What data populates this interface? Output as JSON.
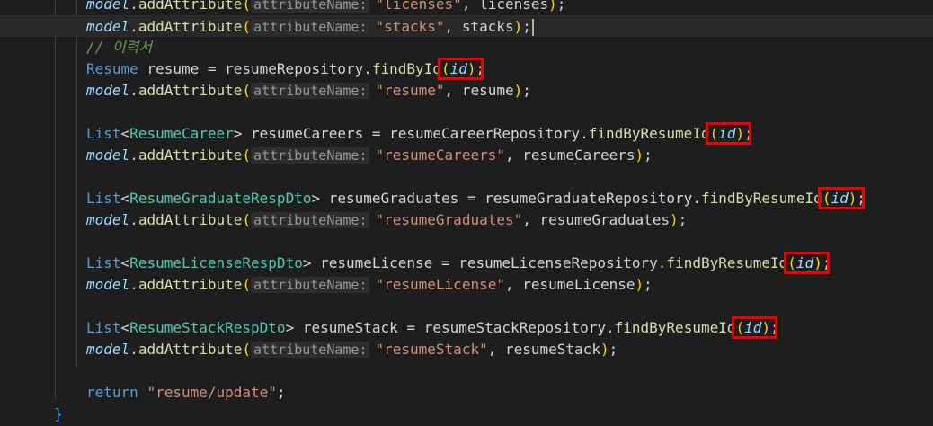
{
  "editor": {
    "hint_label": "attributeName:",
    "lines": [
      {
        "indent": 2,
        "tokens": [
          [
            "model",
            "var"
          ],
          [
            ".",
            "plain"
          ],
          [
            "addAttribute",
            "fn"
          ],
          [
            "(",
            "p1"
          ],
          [
            "HINT",
            "hint"
          ],
          [
            "\"licenses\"",
            "str"
          ],
          [
            ", ",
            "plain"
          ],
          [
            "licenses",
            "plain"
          ],
          [
            ")",
            "p1"
          ],
          [
            ";",
            "plain"
          ]
        ]
      },
      {
        "indent": 2,
        "current": true,
        "cursor": true,
        "tokens": [
          [
            "model",
            "var"
          ],
          [
            ".",
            "plain"
          ],
          [
            "addAttribute",
            "fn"
          ],
          [
            "(",
            "p1"
          ],
          [
            "HINT",
            "hint"
          ],
          [
            "\"stacks\"",
            "str"
          ],
          [
            ", ",
            "plain"
          ],
          [
            "stacks",
            "plain"
          ],
          [
            ")",
            "p1"
          ],
          [
            ";",
            "plain"
          ]
        ]
      },
      {
        "indent": 2,
        "tokens": [
          [
            "// 이력서",
            "cmt"
          ]
        ]
      },
      {
        "indent": 2,
        "tokens": [
          [
            "Resume",
            "kw"
          ],
          [
            " resume = ",
            "plain"
          ],
          [
            "resumeRepository",
            "plain"
          ],
          [
            ".",
            "plain"
          ],
          [
            "findById",
            "fn"
          ],
          [
            "(",
            "p1"
          ],
          [
            "id",
            "var"
          ],
          [
            ")",
            "p1"
          ],
          [
            ";",
            "plain"
          ]
        ]
      },
      {
        "indent": 2,
        "tokens": [
          [
            "model",
            "var"
          ],
          [
            ".",
            "plain"
          ],
          [
            "addAttribute",
            "fn"
          ],
          [
            "(",
            "p1"
          ],
          [
            "HINT",
            "hint"
          ],
          [
            "\"resume\"",
            "str"
          ],
          [
            ", ",
            "plain"
          ],
          [
            "resume",
            "plain"
          ],
          [
            ")",
            "p1"
          ],
          [
            ";",
            "plain"
          ]
        ]
      },
      {
        "indent": 2,
        "tokens": []
      },
      {
        "indent": 2,
        "tokens": [
          [
            "List",
            "kw"
          ],
          [
            "<",
            "plain"
          ],
          [
            "ResumeCareer",
            "type"
          ],
          [
            "> ",
            "plain"
          ],
          [
            "resumeCareers = resumeCareerRepository",
            "plain"
          ],
          [
            ".",
            "plain"
          ],
          [
            "findByResumeId",
            "fn"
          ],
          [
            "(",
            "p1"
          ],
          [
            "id",
            "var"
          ],
          [
            ")",
            "p1"
          ],
          [
            ";",
            "plain"
          ]
        ]
      },
      {
        "indent": 2,
        "tokens": [
          [
            "model",
            "var"
          ],
          [
            ".",
            "plain"
          ],
          [
            "addAttribute",
            "fn"
          ],
          [
            "(",
            "p1"
          ],
          [
            "HINT",
            "hint"
          ],
          [
            "\"resumeCareers\"",
            "str"
          ],
          [
            ", ",
            "plain"
          ],
          [
            "resumeCareers",
            "plain"
          ],
          [
            ")",
            "p1"
          ],
          [
            ";",
            "plain"
          ]
        ]
      },
      {
        "indent": 2,
        "tokens": []
      },
      {
        "indent": 2,
        "tokens": [
          [
            "List",
            "kw"
          ],
          [
            "<",
            "plain"
          ],
          [
            "ResumeGraduateRespDto",
            "type"
          ],
          [
            "> ",
            "plain"
          ],
          [
            "resumeGraduates = resumeGraduateRepository",
            "plain"
          ],
          [
            ".",
            "plain"
          ],
          [
            "findByResumeId",
            "fn"
          ],
          [
            "(",
            "p1"
          ],
          [
            "id",
            "var"
          ],
          [
            ")",
            "p1"
          ],
          [
            ";",
            "plain"
          ]
        ]
      },
      {
        "indent": 2,
        "tokens": [
          [
            "model",
            "var"
          ],
          [
            ".",
            "plain"
          ],
          [
            "addAttribute",
            "fn"
          ],
          [
            "(",
            "p1"
          ],
          [
            "HINT",
            "hint"
          ],
          [
            "\"resumeGraduates\"",
            "str"
          ],
          [
            ", ",
            "plain"
          ],
          [
            "resumeGraduates",
            "plain"
          ],
          [
            ")",
            "p1"
          ],
          [
            ";",
            "plain"
          ]
        ]
      },
      {
        "indent": 2,
        "tokens": []
      },
      {
        "indent": 2,
        "tokens": [
          [
            "List",
            "kw"
          ],
          [
            "<",
            "plain"
          ],
          [
            "ResumeLicenseRespDto",
            "type"
          ],
          [
            "> ",
            "plain"
          ],
          [
            "resumeLicense = resumeLicenseRepository",
            "plain"
          ],
          [
            ".",
            "plain"
          ],
          [
            "findByResumeId",
            "fn"
          ],
          [
            "(",
            "p1"
          ],
          [
            "id",
            "var"
          ],
          [
            ")",
            "p1"
          ],
          [
            ";",
            "plain"
          ]
        ]
      },
      {
        "indent": 2,
        "tokens": [
          [
            "model",
            "var"
          ],
          [
            ".",
            "plain"
          ],
          [
            "addAttribute",
            "fn"
          ],
          [
            "(",
            "p1"
          ],
          [
            "HINT",
            "hint"
          ],
          [
            "\"resumeLicense\"",
            "str"
          ],
          [
            ", ",
            "plain"
          ],
          [
            "resumeLicense",
            "plain"
          ],
          [
            ")",
            "p1"
          ],
          [
            ";",
            "plain"
          ]
        ]
      },
      {
        "indent": 2,
        "tokens": []
      },
      {
        "indent": 2,
        "tokens": [
          [
            "List",
            "kw"
          ],
          [
            "<",
            "plain"
          ],
          [
            "ResumeStackRespDto",
            "type"
          ],
          [
            "> ",
            "plain"
          ],
          [
            "resumeStack = resumeStackRepository",
            "plain"
          ],
          [
            ".",
            "plain"
          ],
          [
            "findByResumeId",
            "fn"
          ],
          [
            "(",
            "p1"
          ],
          [
            "id",
            "var"
          ],
          [
            ")",
            "p1"
          ],
          [
            ";",
            "plain"
          ]
        ]
      },
      {
        "indent": 2,
        "tokens": [
          [
            "model",
            "var"
          ],
          [
            ".",
            "plain"
          ],
          [
            "addAttribute",
            "fn"
          ],
          [
            "(",
            "p1"
          ],
          [
            "HINT",
            "hint"
          ],
          [
            "\"resumeStack\"",
            "str"
          ],
          [
            ", ",
            "plain"
          ],
          [
            "resumeStack",
            "plain"
          ],
          [
            ")",
            "p1"
          ],
          [
            ";",
            "plain"
          ]
        ]
      },
      {
        "indent": 2,
        "tokens": []
      },
      {
        "indent": 2,
        "tokens": [
          [
            "return",
            "kw"
          ],
          [
            " ",
            "plain"
          ],
          [
            "\"resume/update\"",
            "str"
          ],
          [
            ";",
            "plain"
          ]
        ]
      },
      {
        "indent": 1,
        "tokens": [
          [
            "}",
            "p3"
          ]
        ]
      }
    ]
  },
  "highlights": [
    {
      "label": "findById-id-arg"
    },
    {
      "label": "resumeCareers-id-arg"
    },
    {
      "label": "resumeGraduates-id-arg"
    },
    {
      "label": "resumeLicense-id-arg"
    },
    {
      "label": "resumeStack-id-arg"
    }
  ],
  "colors": {
    "background": "#1e1e1e",
    "highlight_box": "#f00000",
    "bracket_gold": "#ffd700",
    "string": "#ce9178",
    "function": "#dcdcaa",
    "type": "#4ec9b0",
    "keyword": "#569cd6"
  }
}
